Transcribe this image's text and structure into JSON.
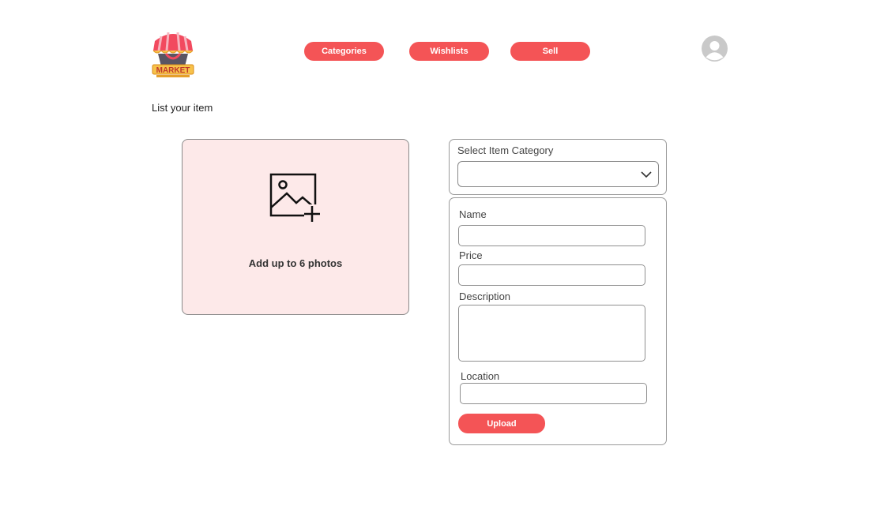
{
  "brand": {
    "logo_text": "MARKET"
  },
  "nav": {
    "categories": "Categories",
    "wishlists": "Wishlists",
    "sell": "Sell"
  },
  "user": {
    "avatar_icon": "user-avatar-icon"
  },
  "page": {
    "title": "List your item"
  },
  "photos": {
    "icon": "add-image-icon",
    "label": "Add up to 6 photos"
  },
  "category": {
    "label": "Select Item Category",
    "selected": "",
    "icon": "chevron-down-icon"
  },
  "form": {
    "name_label": "Name",
    "name_value": "",
    "price_label": "Price",
    "price_value": "",
    "description_label": "Description",
    "description_value": "",
    "location_label": "Location",
    "location_value": "",
    "upload_label": "Upload"
  },
  "colors": {
    "accent": "#f45456",
    "photo_bg": "#fde9e9",
    "border": "#9a9a9a"
  }
}
